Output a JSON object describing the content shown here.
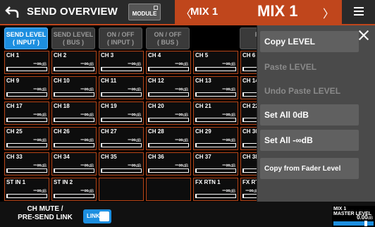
{
  "header": {
    "title": "SEND OVERVIEW",
    "module_label": "MODULE",
    "prev_glyph": "〈",
    "mix_name": "MIX 1",
    "mix_name_big": "MIX 1",
    "next_glyph": "〉"
  },
  "tabs": [
    {
      "line1": "SEND LEVEL",
      "line2": "( INPUT )"
    },
    {
      "line1": "SEND LEVEL",
      "line2": "( BUS )"
    },
    {
      "line1": "ON / OFF",
      "line2": "( INPUT )"
    },
    {
      "line1": "ON / OFF",
      "line2": "( BUS )"
    },
    {
      "line1": "PRE",
      "line2": "( IN"
    }
  ],
  "grid": {
    "rows": [
      [
        {
          "name": "CH 1",
          "level": "−∞",
          "unit": "dB"
        },
        {
          "name": "CH 2",
          "level": "−∞",
          "unit": "dB"
        },
        {
          "name": "CH 3",
          "level": "−∞",
          "unit": "dB"
        },
        {
          "name": "CH 4",
          "level": "−∞",
          "unit": "dB"
        },
        {
          "name": "CH 5",
          "level": "−∞",
          "unit": "dB"
        },
        {
          "name": "CH 6",
          "level": "",
          "unit": ""
        }
      ],
      [
        {
          "name": "CH 9",
          "level": "−∞",
          "unit": "dB"
        },
        {
          "name": "CH 10",
          "level": "−∞",
          "unit": "dB"
        },
        {
          "name": "CH 11",
          "level": "−∞",
          "unit": "dB"
        },
        {
          "name": "CH 12",
          "level": "−∞",
          "unit": "dB"
        },
        {
          "name": "CH 13",
          "level": "−∞",
          "unit": "dB"
        },
        {
          "name": "CH 14",
          "level": "",
          "unit": ""
        }
      ],
      [
        {
          "name": "CH 17",
          "level": "−∞",
          "unit": "dB"
        },
        {
          "name": "CH 18",
          "level": "−∞",
          "unit": "dB"
        },
        {
          "name": "CH 19",
          "level": "−∞",
          "unit": "dB"
        },
        {
          "name": "CH 20",
          "level": "−∞",
          "unit": "dB"
        },
        {
          "name": "CH 21",
          "level": "−∞",
          "unit": "dB"
        },
        {
          "name": "CH 22",
          "level": "",
          "unit": ""
        }
      ],
      [
        {
          "name": "CH 25",
          "level": "−∞",
          "unit": "dB"
        },
        {
          "name": "CH 26",
          "level": "−∞",
          "unit": "dB"
        },
        {
          "name": "CH 27",
          "level": "−∞",
          "unit": "dB"
        },
        {
          "name": "CH 28",
          "level": "−∞",
          "unit": "dB"
        },
        {
          "name": "CH 29",
          "level": "−∞",
          "unit": "dB"
        },
        {
          "name": "CH 30",
          "level": "",
          "unit": ""
        }
      ],
      [
        {
          "name": "CH 33",
          "level": "−∞",
          "unit": "dB"
        },
        {
          "name": "CH 34",
          "level": "−∞",
          "unit": "dB"
        },
        {
          "name": "CH 35",
          "level": "−∞",
          "unit": "dB"
        },
        {
          "name": "CH 36",
          "level": "−∞",
          "unit": "dB"
        },
        {
          "name": "CH 37",
          "level": "−∞",
          "unit": "dB"
        },
        {
          "name": "CH 38",
          "level": "",
          "unit": ""
        }
      ],
      [
        {
          "name": "ST IN 1",
          "level": "−∞",
          "unit": "dB"
        },
        {
          "name": "ST IN 2",
          "level": "−∞",
          "unit": "dB"
        },
        {
          "name": "",
          "level": "",
          "unit": "",
          "empty": true
        },
        {
          "name": "",
          "level": "",
          "unit": "",
          "empty": true
        },
        {
          "name": "FX RTN 1",
          "level": "−∞",
          "unit": "dB"
        },
        {
          "name": "FX RT",
          "level": "−∞",
          "unit": "dB"
        }
      ]
    ],
    "extra_row6": [
      {
        "level": "−∞",
        "unit": "dB"
      },
      {
        "level": "−∞",
        "unit": "dB"
      },
      {
        "level": "−∞",
        "unit": ""
      }
    ]
  },
  "bottom": {
    "mute_line1": "CH MUTE /",
    "mute_line2": "PRE-SEND LINK",
    "link_label": "LINK",
    "master_line1": "MIX 1",
    "master_line2": "MASTER LEVEL",
    "master_value": "0.00",
    "master_unit": "dB"
  },
  "popup": {
    "items": [
      {
        "label": "Copy LEVEL",
        "enabled": true
      },
      {
        "label": "Paste LEVEL",
        "enabled": false
      },
      {
        "label": "Undo Paste LEVEL",
        "enabled": false
      },
      {
        "label": "Set All 0dB",
        "enabled": true
      },
      {
        "label": "Set All -∞dB",
        "enabled": true
      },
      {
        "label": "Copy from Fader Level",
        "enabled": true
      }
    ]
  },
  "colors": {
    "accent_orange": "#c0461c",
    "accent_blue": "#1d8fe0"
  }
}
